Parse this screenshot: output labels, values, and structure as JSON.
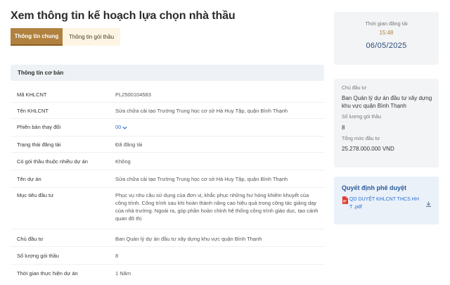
{
  "page": {
    "title": "Xem thông tin kế hoạch lựa chọn nhà thầu"
  },
  "tabs": [
    {
      "label": "Thông tin chung",
      "active": true
    },
    {
      "label": "Thông tin gói thầu",
      "active": false
    }
  ],
  "section": {
    "title": "Thông tin cơ bản"
  },
  "rows": [
    {
      "label": "Mã KHLCNT",
      "value": "PL2500104583"
    },
    {
      "label": "Tên KHLCNT",
      "value": "Sửa chữa cải tạo Trường Trung học cơ sở Hà Huy Tập, quận Bình Thạnh"
    },
    {
      "label": "Phiên bản thay đổi",
      "value": "00"
    },
    {
      "label": "Trạng thái đăng tải",
      "value": "Đã đăng tải"
    },
    {
      "label": "Có gói thầu thuộc nhiều dự án",
      "value": "Không"
    },
    {
      "label": "Tên dự án",
      "value": "Sửa chữa cải tạo Trường Trung học cơ sở Hà Huy Tập, quận Bình Thạnh"
    },
    {
      "label": "Mục tiêu đầu tư",
      "value": "Phục vụ nhu cầu sử dụng của đơn vị, khắc phục những hư hỏng khiếm khuyết của công trình. Công trình sau khi hoàn thành nâng cao hiệu quả trong công tác giảng dạy của nhà trường. Ngoài ra, góp phần hoàn chỉnh hệ thống công trình giáo dục, tạo cảnh quan đô thị"
    },
    {
      "label": "Chủ đầu tư",
      "value": "Ban Quản lý dự án đầu tư xây dựng khu vực quận Bình Thạnh"
    },
    {
      "label": "Số lượng gói thầu",
      "value": "8"
    },
    {
      "label": "Thời gian thực hiện dự án",
      "value": "1 Năm"
    }
  ],
  "time_panel": {
    "label": "Thời gian đăng tải",
    "time": "15:48",
    "date": "06/05/2025"
  },
  "owner_panel": {
    "owner_label": "Chủ đầu tư",
    "owner_value": "Ban Quản lý dự án đầu tư xây dựng khu vực quận Bình Thạnh",
    "count_label": "Số lượng gói thầu",
    "count_value": "8",
    "total_label": "Tổng mức đầu tư",
    "total_value": "25.278.000.000 VND"
  },
  "decision_panel": {
    "title": "Quyết định phê duyệt",
    "file_name": "QD DUYỆT KHLCNT THCS HH T .pdf",
    "icons": [
      "pdf-icon",
      "download-icon"
    ]
  },
  "colors": {
    "accent": "#b0813f",
    "link": "#2a6fcf",
    "panel_bg": "#f3f4f6",
    "decision_bg": "#eaf1f9"
  }
}
